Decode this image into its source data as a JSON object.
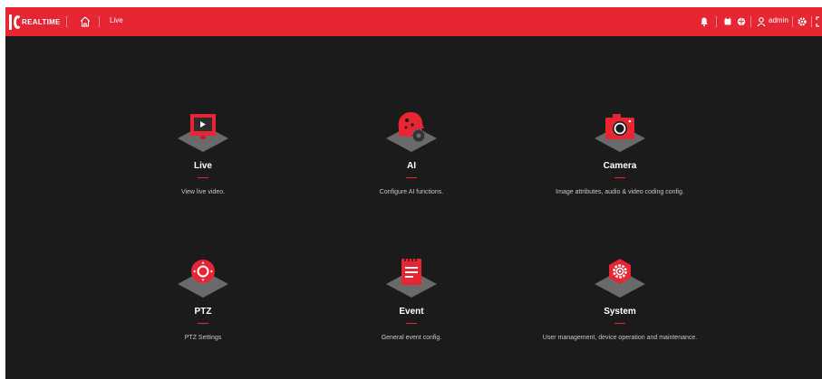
{
  "header": {
    "logo_text": "REALTIME",
    "breadcrumb": "Live",
    "user": "admin"
  },
  "modules": [
    {
      "id": "live",
      "title": "Live",
      "desc": "View live video.",
      "icon": "monitor-play-icon"
    },
    {
      "id": "ai",
      "title": "AI",
      "desc": "Configure AI functions.",
      "icon": "ai-head-gear-icon"
    },
    {
      "id": "camera",
      "title": "Camera",
      "desc": "Image attributes, audio & video coding config.",
      "icon": "camera-icon"
    },
    {
      "id": "ptz",
      "title": "PTZ",
      "desc": "PTZ Settings",
      "icon": "ptz-joystick-icon"
    },
    {
      "id": "event",
      "title": "Event",
      "desc": "General event config.",
      "icon": "event-notepad-icon"
    },
    {
      "id": "system",
      "title": "System",
      "desc": "User management, device operation and maintenance.",
      "icon": "system-gear-icon"
    }
  ],
  "colors": {
    "accent": "#e82532",
    "background": "#1b1b1b",
    "pedestal": "#6a6a6a"
  }
}
